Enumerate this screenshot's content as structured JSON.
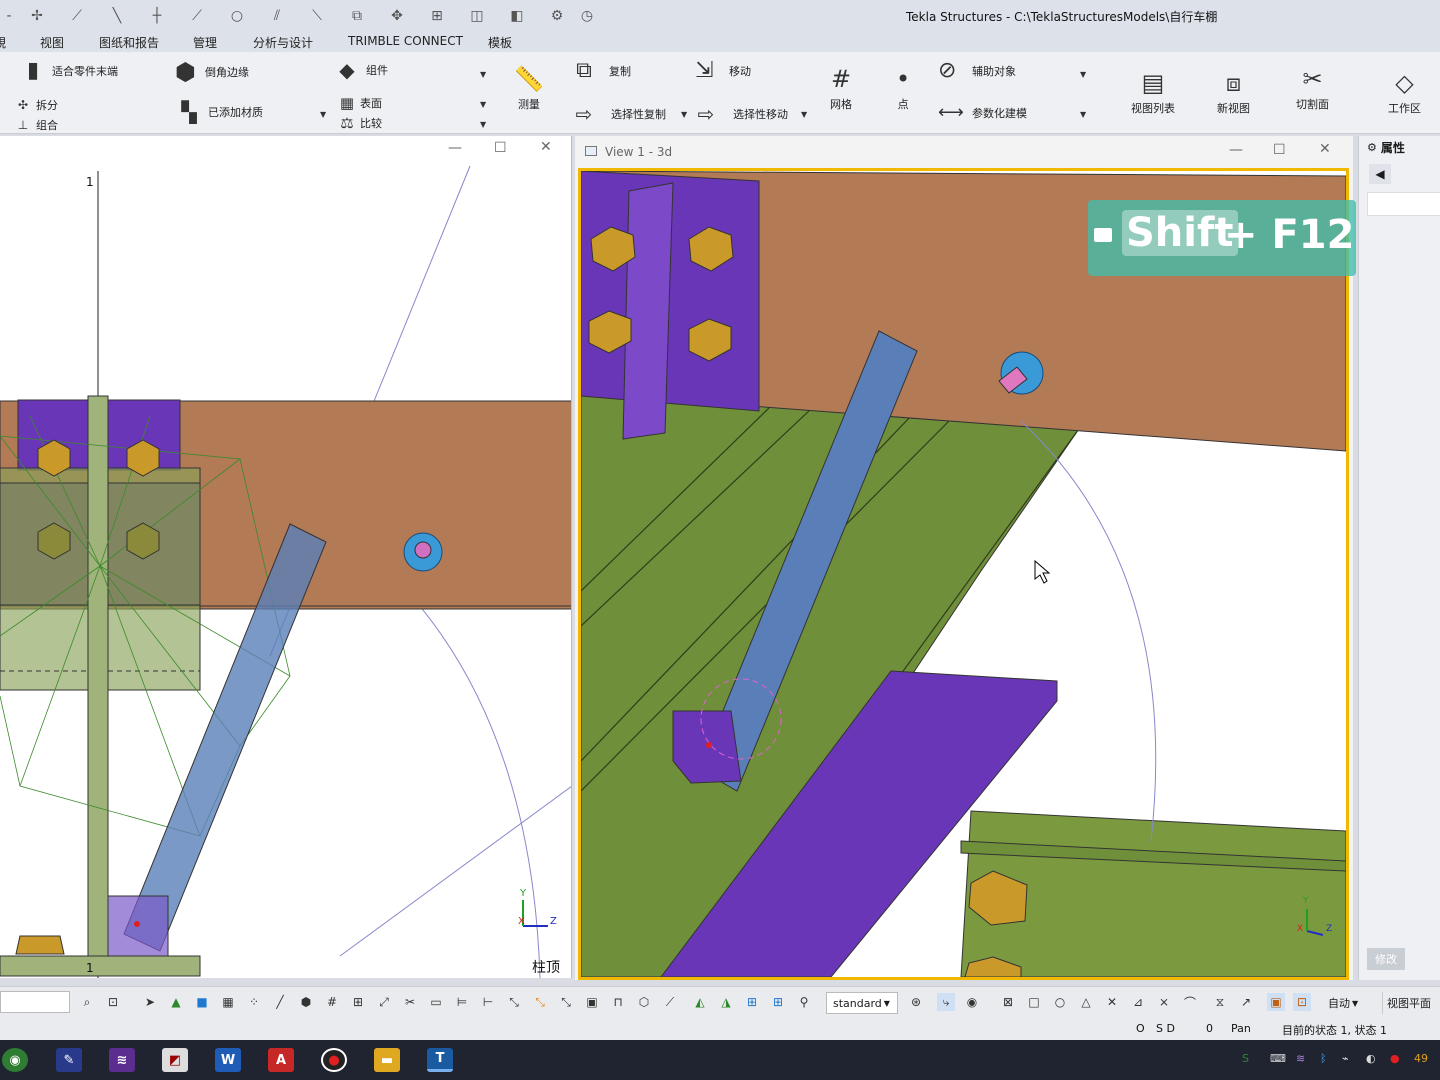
{
  "window": {
    "title": "Tekla Structures - C:\\TeklaStructuresModels\\自行车棚"
  },
  "menu": {
    "tabs": [
      {
        "label": "視"
      },
      {
        "label": "视图"
      },
      {
        "label": "图纸和报告"
      },
      {
        "label": "管理"
      },
      {
        "label": "分析与设计"
      },
      {
        "label": "TRIMBLE CONNECT"
      },
      {
        "label": "模板"
      }
    ]
  },
  "ribbon": {
    "fit_part_end": "适合零件末端",
    "split": "拆分",
    "combine": "组合",
    "chamfer_edge": "倒角边缘",
    "added_material": "已添加材质",
    "component": "组件",
    "surface": "表面",
    "compare": "比较",
    "measure": "测量",
    "copy": "复制",
    "copy_special": "选择性复制",
    "move": "移动",
    "move_special": "选择性移动",
    "grid": "网格",
    "point": "点",
    "helper_object": "辅助对象",
    "parametric_modeling": "参数化建模",
    "view_list": "视图列表",
    "new_view": "新视图",
    "clip_plane": "切割面",
    "work_area": "工作区"
  },
  "left_view": {
    "grid_label_top": "1",
    "grid_label_bottom": "1",
    "view_name": "柱顶",
    "axis_y": "Y",
    "axis_x": "X",
    "axis_z": "Z"
  },
  "right_view": {
    "title": "View 1 - 3d",
    "axis_y": "Y",
    "axis_x": "X",
    "axis_z": "Z"
  },
  "shortcut_overlay": {
    "key1": "Shift",
    "key2": "+ F12"
  },
  "properties": {
    "title": "属性",
    "modify_button": "修改"
  },
  "toolbar": {
    "select_filter": "standard",
    "snap_mode": "自动",
    "view_plane": "视图平面"
  },
  "status": {
    "o": "O",
    "sd": "S D",
    "zero": "0",
    "pan": "Pan",
    "state": "目前的状态 1, 状态 1"
  },
  "taskbar": {
    "tray_number": "49"
  },
  "colors": {
    "beam_brown": "#b27a55",
    "plate_purple": "#6a36b8",
    "green_member": "#6f8f3a",
    "bolt_gold": "#c99a2a",
    "brace_blue": "#5a7fb8",
    "selection_frame": "#f0b800"
  }
}
